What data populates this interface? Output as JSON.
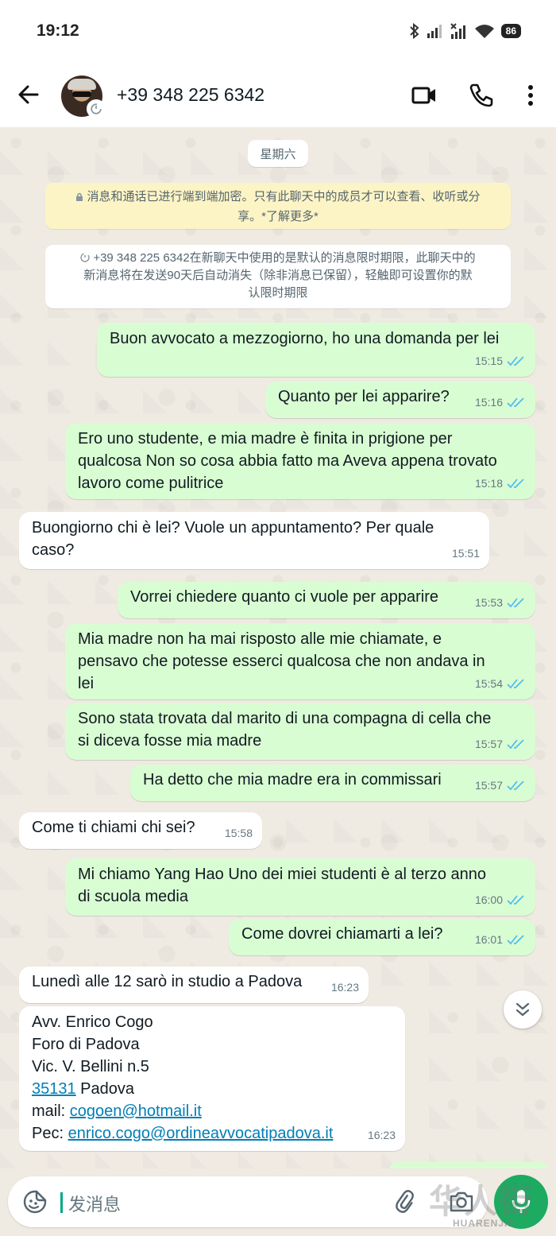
{
  "status_bar": {
    "time": "19:12",
    "battery": "86"
  },
  "header": {
    "contact_name": "+39 348 225 6342"
  },
  "chat": {
    "date_chip": "星期六",
    "e2e_notice_line1": "消息和通话已进行端到端加密。只有此聊天中的成员才可以查看、收听或分",
    "e2e_notice_line2": "享。*了解更多*",
    "timer_notice_line1": "+39 348 225 6342在新聊天中使用的是默认的消息限时期限，此聊天中的",
    "timer_notice_line2": "新消息将在发送90天后自动消失（除非消息已保留），轻触即可设置你的默",
    "timer_notice_line3": "认限时期限",
    "messages": [
      {
        "dir": "out",
        "lines": [
          "Buon avvocato a mezzogiorno, ho una domanda per lei"
        ],
        "time": "15:15"
      },
      {
        "dir": "out",
        "lines": [
          "Quanto per lei  apparire?"
        ],
        "time": "15:16"
      },
      {
        "dir": "out",
        "lines": [
          "Ero uno studente, e mia madre è finita in prigione per",
          "qualcosa Non so cosa abbia fatto ma Aveva appena trovato",
          "lavoro come pulitrice"
        ],
        "time": "15:18"
      },
      {
        "dir": "in",
        "lines": [
          "Buongiorno chi è lei? Vuole un appuntamento? Per quale",
          "caso?"
        ],
        "time": "15:51"
      },
      {
        "dir": "out",
        "lines": [
          "Vorrei chiedere quanto ci vuole per apparire"
        ],
        "time": "15:53"
      },
      {
        "dir": "out",
        "lines": [
          "Mia madre non ha mai risposto alle mie chiamate, e",
          "pensavo che potesse esserci qualcosa che non andava in",
          "lei"
        ],
        "time": "15:54"
      },
      {
        "dir": "out",
        "lines": [
          "Sono stata trovata dal marito di una compagna di cella che",
          "si diceva fosse mia madre"
        ],
        "time": "15:57"
      },
      {
        "dir": "out",
        "lines": [
          "Ha detto che mia madre era in commissari"
        ],
        "time": "15:57"
      },
      {
        "dir": "in",
        "lines": [
          "Come ti chiami chi sei?"
        ],
        "time": "15:58"
      },
      {
        "dir": "out",
        "lines": [
          "Mi chiamo Yang Hao Uno dei miei studenti è al terzo anno",
          "di scuola media"
        ],
        "time": "16:00"
      },
      {
        "dir": "out",
        "lines": [
          "Come dovrei chiamarti a lei?"
        ],
        "time": "16:01"
      },
      {
        "dir": "in",
        "lines": [
          "Lunedì alle 12 sarò in studio a Padova"
        ],
        "time": "16:23"
      }
    ],
    "contact_card": {
      "line1": "Avv. Enrico Cogo",
      "line2": "Foro di Padova",
      "line3": "Vic. V. Bellini n.5",
      "zip": "35131",
      "city": " Padova",
      "mail_label": "mail: ",
      "mail": "cogoen@hotmail.it",
      "pec_label": "Pec: ",
      "pec": "enrico.cogo@ordineavvocatipadova.it",
      "time": "16:23"
    }
  },
  "composer": {
    "placeholder": "发消息"
  },
  "watermark": {
    "main": "华人街",
    "sub": "HUARENJIE"
  },
  "colors": {
    "outgoing": "#d9fdd3",
    "incoming": "#ffffff",
    "accent": "#1daa61",
    "tick": "#53bdeb"
  },
  "icons": [
    "back-arrow-icon",
    "video-call-icon",
    "phone-icon",
    "more-vert-icon",
    "lock-icon",
    "timer-icon",
    "double-check-icon",
    "chevron-down-icon",
    "emoji-sticker-icon",
    "attach-icon",
    "camera-icon",
    "mic-icon"
  ]
}
